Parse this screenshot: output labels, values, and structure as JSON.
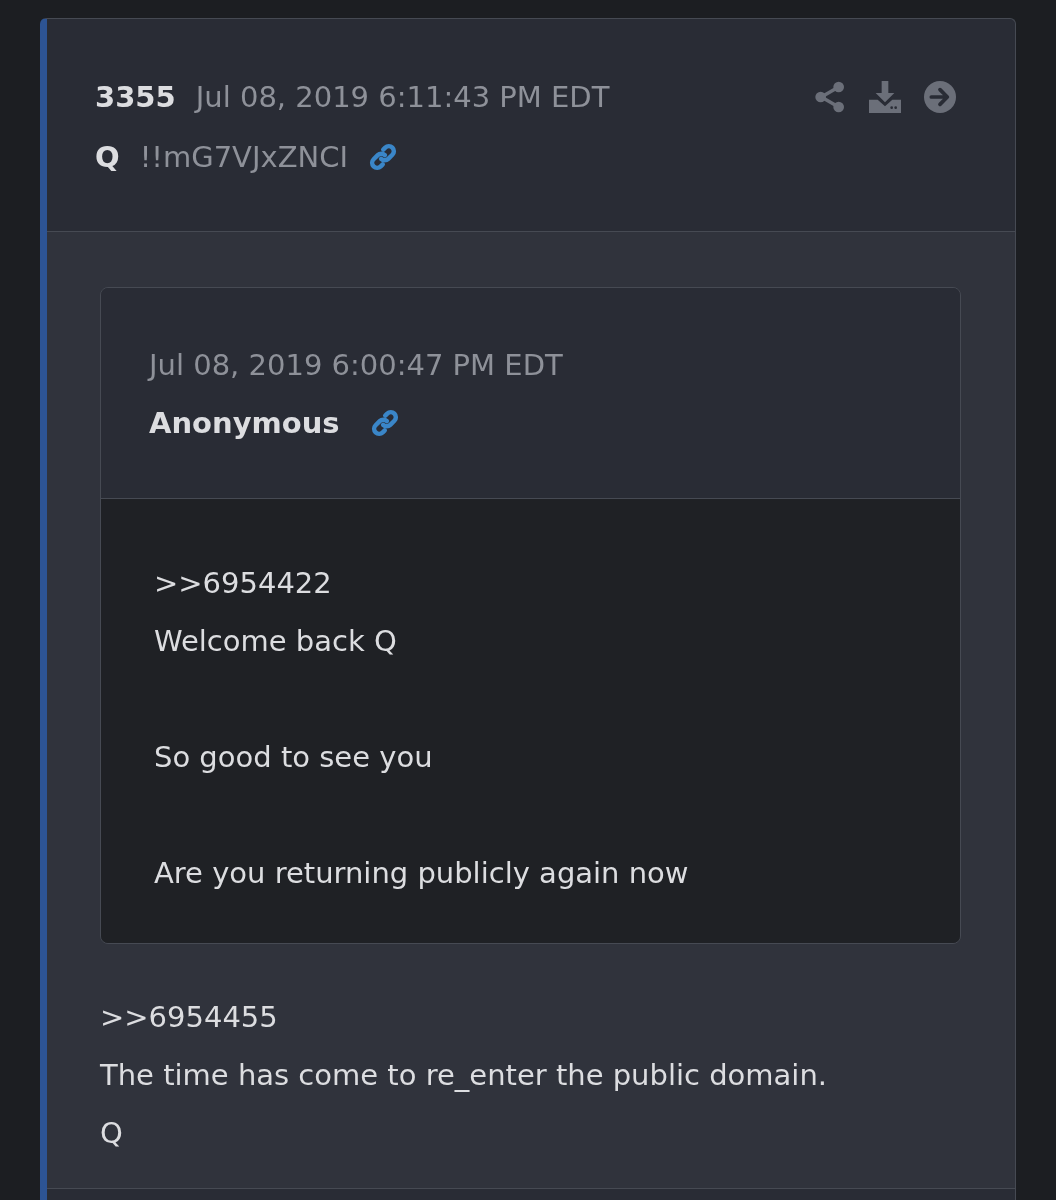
{
  "post": {
    "number": "3355",
    "timestamp": "Jul 08, 2019 6:11:43 PM EDT",
    "author": "Q",
    "tripcode": "!!mG7VJxZNCI",
    "actions": [
      {
        "kind": "share"
      },
      {
        "kind": "download"
      },
      {
        "kind": "open"
      }
    ]
  },
  "quoted_post": {
    "timestamp": "Jul 08, 2019 6:00:47 PM EDT",
    "author": "Anonymous",
    "paragraphs": [
      [
        ">>6954422",
        "Welcome back Q"
      ],
      [
        "So good to see you"
      ],
      [
        "Are you returning publicly again now"
      ]
    ]
  },
  "message": {
    "lines": [
      ">>6954455",
      "The time has come to re_enter the public domain.",
      "Q"
    ]
  }
}
